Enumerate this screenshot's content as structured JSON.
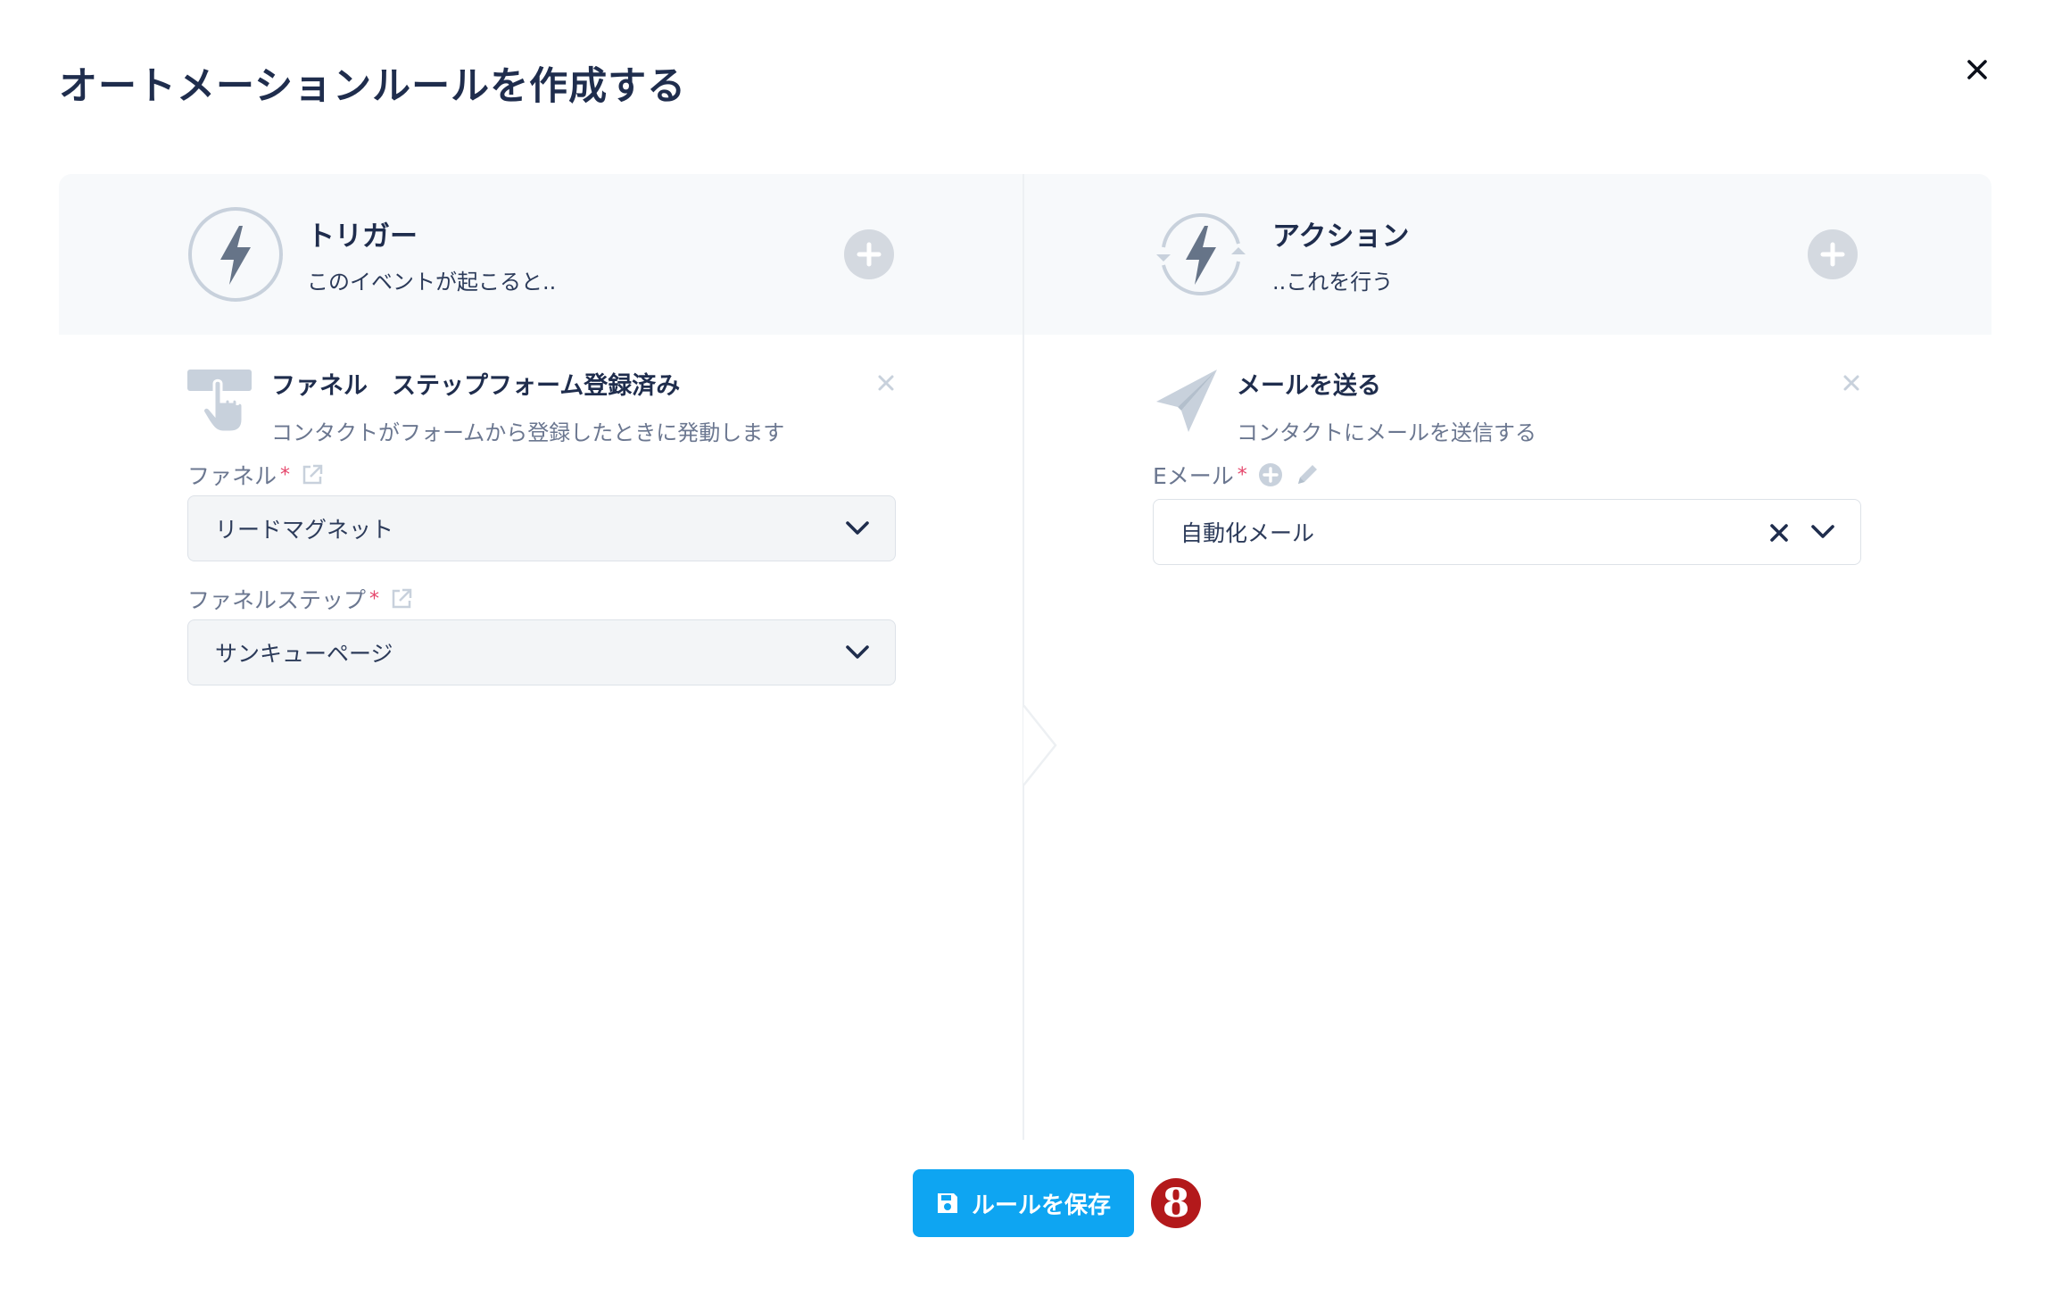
{
  "dialog": {
    "title": "オートメーションルールを作成する"
  },
  "trigger": {
    "title": "トリガー",
    "subtitle": "このイベントが起こると..",
    "item": {
      "title": "ファネル　ステップフォーム登録済み",
      "description": "コンタクトがフォームから登録したときに発動します"
    },
    "fields": [
      {
        "label": "ファネル",
        "required_mark": "*",
        "value": "リードマグネット"
      },
      {
        "label": "ファネルステップ",
        "required_mark": "*",
        "value": "サンキューページ"
      }
    ]
  },
  "action": {
    "title": "アクション",
    "subtitle": "..これを行う",
    "item": {
      "title": "メールを送る",
      "description": "コンタクトにメールを送信する"
    },
    "field": {
      "label": "Eメール",
      "required_mark": "*",
      "value": "自動化メール"
    }
  },
  "footer": {
    "save_label": "ルールを保存",
    "step_badge": "8"
  },
  "icons": {
    "close": "close-icon",
    "bolt": "lightning-bolt-icon",
    "add": "plus-circle-icon",
    "hand": "pointer-hand-icon",
    "plane": "paper-plane-icon",
    "external": "external-link-icon",
    "pencil": "pencil-icon",
    "chevron": "chevron-down-icon",
    "save": "floppy-disk-icon"
  },
  "colors": {
    "primary": "#0ea5f2",
    "heading": "#1f2d4d",
    "muted": "#6b7790",
    "required": "#e5466b",
    "icon_gray": "#c8d1dc",
    "badge": "#b3191b"
  }
}
